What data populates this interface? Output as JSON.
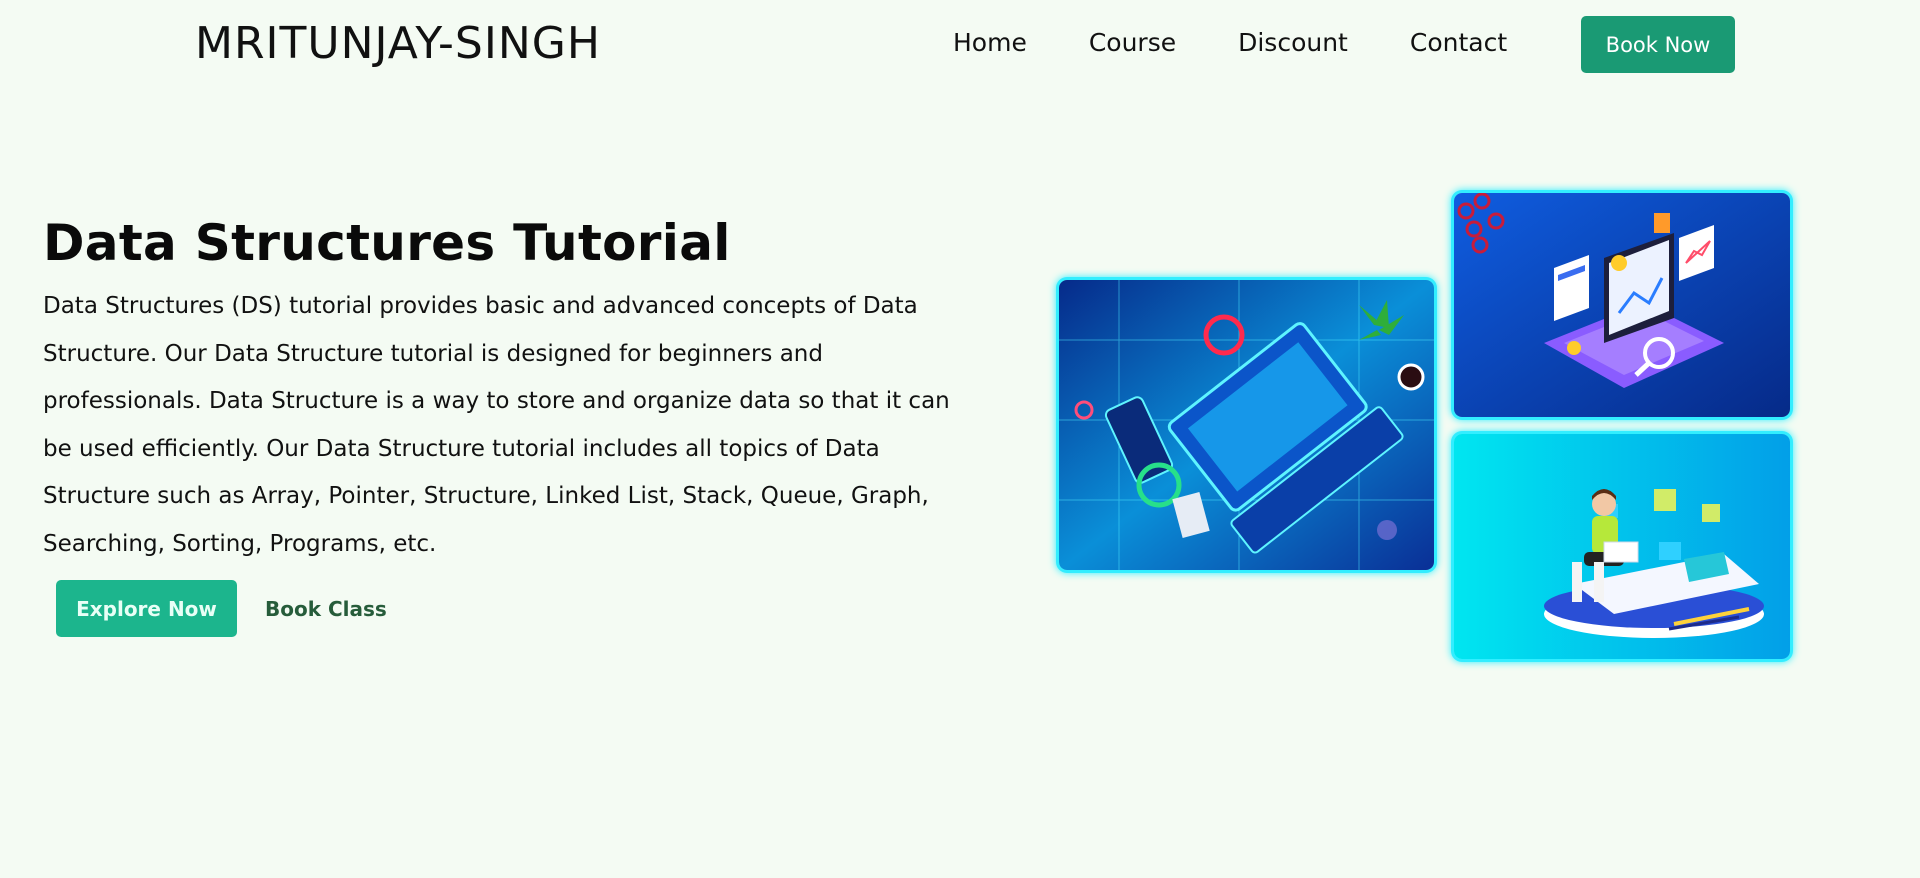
{
  "header": {
    "logo": "MRITUNJAY-SINGH",
    "nav": [
      "Home",
      "Course",
      "Discount",
      "Contact"
    ],
    "cta": "Book Now"
  },
  "hero": {
    "title": "Data Structures Tutorial",
    "description": "Data Structures (DS) tutorial provides basic and advanced concepts of Data Structure. Our Data Structure tutorial is designed for beginners and professionals. Data Structure is a way to store and organize data so that it can be used efficiently. Our Data Structure tutorial includes all topics of Data Structure such as Array, Pointer, Structure, Linked List, Stack, Queue, Graph, Searching, Sorting, Programs, etc.",
    "primary_button": "Explore Now",
    "secondary_link": "Book Class"
  },
  "colors": {
    "background": "#f4fbf3",
    "accent": "#1a9a74",
    "accent_light": "#1cb58d",
    "link_green": "#265c3a",
    "glow": "#2ef0ff"
  }
}
